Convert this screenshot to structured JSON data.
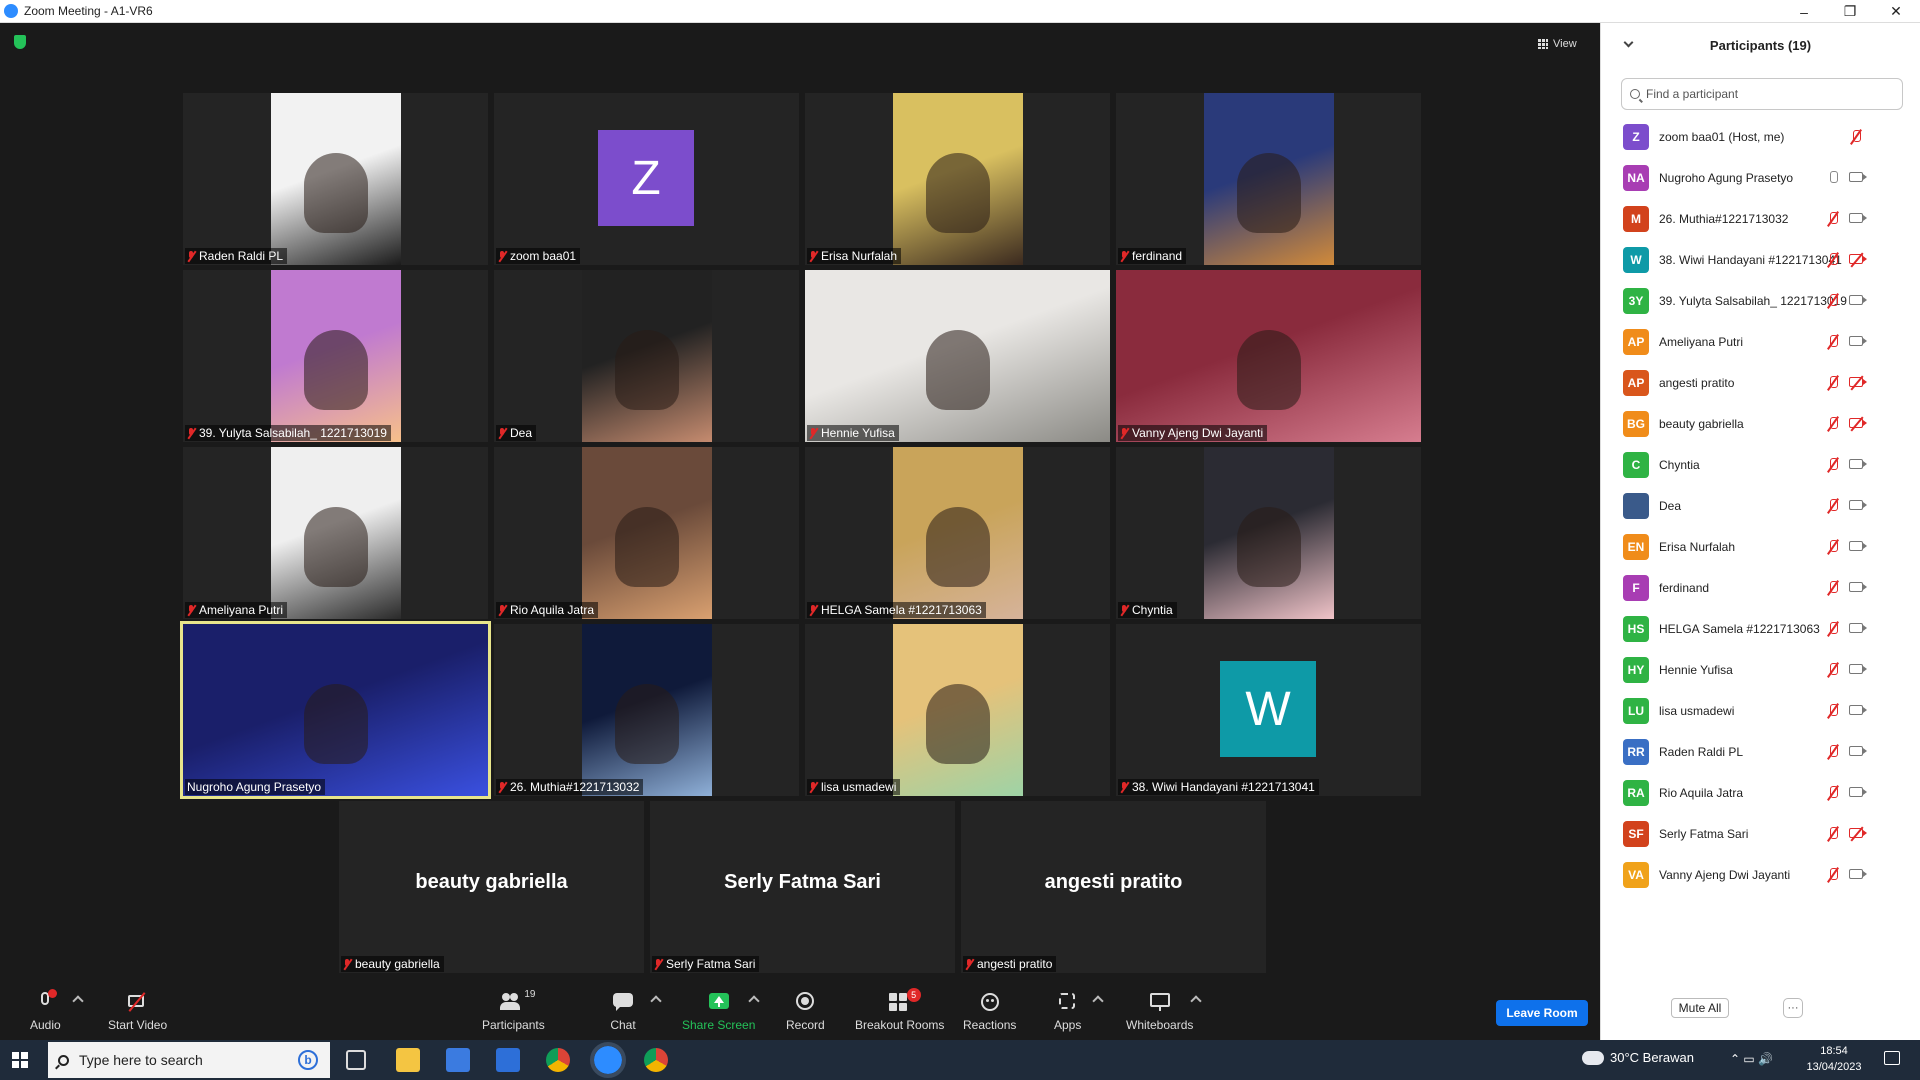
{
  "window": {
    "title": "Zoom Meeting - A1-VR6",
    "minimize": "–",
    "maximize": "❐",
    "close": "✕"
  },
  "meeting": {
    "view_label": "View"
  },
  "tiles": [
    {
      "name": "Raden Raldi PL",
      "muted": true,
      "kind": "video",
      "colors": [
        "#f2f2f2",
        "#1b1b1b"
      ]
    },
    {
      "name": "zoom baa01",
      "muted": true,
      "kind": "avatar",
      "initial": "Z",
      "avatar_color": "#7c4dcc"
    },
    {
      "name": "Erisa Nurfalah",
      "muted": true,
      "kind": "video",
      "colors": [
        "#d9c060",
        "#3b2a1f"
      ]
    },
    {
      "name": "ferdinand",
      "muted": true,
      "kind": "video",
      "colors": [
        "#2a3a7a",
        "#d18a3a"
      ]
    },
    {
      "name": "39. Yulyta Salsabilah_ 1221713019",
      "muted": true,
      "kind": "video",
      "colors": [
        "#c07ad0",
        "#f7c08a"
      ]
    },
    {
      "name": "Dea",
      "muted": true,
      "kind": "video",
      "colors": [
        "#222222",
        "#c58b6f"
      ]
    },
    {
      "name": "Hennie Yufisa",
      "muted": true,
      "kind": "video_full",
      "colors": [
        "#e9e7e4",
        "#8b8a85"
      ]
    },
    {
      "name": "Vanny Ajeng Dwi Jayanti",
      "muted": true,
      "kind": "video_full",
      "colors": [
        "#8a2b3d",
        "#d67d8f"
      ]
    },
    {
      "name": "Ameliyana Putri",
      "muted": true,
      "kind": "video",
      "colors": [
        "#efefef",
        "#2a2a2a"
      ]
    },
    {
      "name": "Rio Aquila Jatra",
      "muted": true,
      "kind": "video",
      "colors": [
        "#6a4a3a",
        "#d9a070"
      ]
    },
    {
      "name": "HELGA Samela #1221713063",
      "muted": true,
      "kind": "video",
      "colors": [
        "#c9a45a",
        "#d6b39a"
      ]
    },
    {
      "name": "Chyntia",
      "muted": true,
      "kind": "video",
      "colors": [
        "#2b2b33",
        "#f0c3c8"
      ]
    },
    {
      "name": "Nugroho Agung Prasetyo",
      "muted": false,
      "kind": "video_full",
      "active": true,
      "colors": [
        "#1a1f6a",
        "#3a50e0"
      ]
    },
    {
      "name": "26. Muthia#1221713032",
      "muted": true,
      "kind": "video",
      "colors": [
        "#0f1a3a",
        "#8fb0d8"
      ]
    },
    {
      "name": "lisa usmadewi",
      "muted": true,
      "kind": "video",
      "colors": [
        "#e5c27a",
        "#9ed3a6"
      ]
    },
    {
      "name": "38. Wiwi Handayani #1221713041",
      "muted": true,
      "kind": "avatar",
      "initial": "W",
      "avatar_color": "#0e9aa7"
    },
    {
      "name": "beauty gabriella",
      "muted": true,
      "kind": "name_only"
    },
    {
      "name": "Serly Fatma Sari",
      "muted": true,
      "kind": "name_only"
    },
    {
      "name": "angesti pratito",
      "muted": true,
      "kind": "name_only"
    }
  ],
  "toolbar": {
    "audio": "Audio",
    "start_video": "Start Video",
    "participants": "Participants",
    "participants_count": "19",
    "chat": "Chat",
    "share_screen": "Share Screen",
    "record": "Record",
    "breakout_rooms": "Breakout Rooms",
    "breakout_badge": "5",
    "reactions": "Reactions",
    "apps": "Apps",
    "whiteboards": "Whiteboards",
    "leave": "Leave Room",
    "accent": "#0e71eb",
    "share_color": "#24c259"
  },
  "panel": {
    "title": "Participants (19)",
    "search_placeholder": "Find a participant",
    "mute_all": "Mute All",
    "more": "···",
    "participants": [
      {
        "initials": "Z",
        "name": "zoom baa01 (Host, me)",
        "color": "#7c4dcc",
        "mic": "off",
        "cam": "none"
      },
      {
        "initials": "NA",
        "name": "Nugroho Agung Prasetyo",
        "color": "#a83db3",
        "mic": "on",
        "cam": "on"
      },
      {
        "initials": "M",
        "name": "26. Muthia#1221713032",
        "color": "#d2421c",
        "mic": "off",
        "cam": "on"
      },
      {
        "initials": "W",
        "name": "38. Wiwi Handayani #1221713041",
        "color": "#0e9aa7",
        "mic": "off",
        "cam": "off"
      },
      {
        "initials": "3Y",
        "name": "39. Yulyta Salsabilah_ 1221713019",
        "color": "#2fb344",
        "mic": "off",
        "cam": "on"
      },
      {
        "initials": "AP",
        "name": "Ameliyana Putri",
        "color": "#f08c1a",
        "mic": "off",
        "cam": "on"
      },
      {
        "initials": "AP",
        "name": "angesti pratito",
        "color": "#d9561c",
        "mic": "off",
        "cam": "off"
      },
      {
        "initials": "BG",
        "name": "beauty gabriella",
        "color": "#f08c1a",
        "mic": "off",
        "cam": "off"
      },
      {
        "initials": "C",
        "name": "Chyntia",
        "color": "#2fb344",
        "mic": "off",
        "cam": "on"
      },
      {
        "initials": "",
        "name": "Dea",
        "color": "#3a5a8a",
        "mic": "off",
        "cam": "on"
      },
      {
        "initials": "EN",
        "name": "Erisa Nurfalah",
        "color": "#f08c1a",
        "mic": "off",
        "cam": "on"
      },
      {
        "initials": "F",
        "name": "ferdinand",
        "color": "#a83db3",
        "mic": "off",
        "cam": "on"
      },
      {
        "initials": "HS",
        "name": "HELGA Samela #1221713063",
        "color": "#2fb344",
        "mic": "off",
        "cam": "on"
      },
      {
        "initials": "HY",
        "name": "Hennie Yufisa",
        "color": "#2fb344",
        "mic": "off",
        "cam": "on"
      },
      {
        "initials": "LU",
        "name": "lisa usmadewi",
        "color": "#2fb344",
        "mic": "off",
        "cam": "on"
      },
      {
        "initials": "RR",
        "name": "Raden Raldi PL",
        "color": "#3a6fc4",
        "mic": "off",
        "cam": "on"
      },
      {
        "initials": "RA",
        "name": "Rio Aquila Jatra",
        "color": "#2fb344",
        "mic": "off",
        "cam": "on"
      },
      {
        "initials": "SF",
        "name": "Serly Fatma Sari",
        "color": "#d2421c",
        "mic": "off",
        "cam": "off"
      },
      {
        "initials": "VA",
        "name": "Vanny Ajeng Dwi Jayanti",
        "color": "#f0a21a",
        "mic": "off",
        "cam": "on"
      }
    ]
  },
  "taskbar": {
    "search_placeholder": "Type here to search",
    "bing": "b",
    "weather": "30°C  Berawan",
    "time": "18:54",
    "date": "13/04/2023",
    "tray": "⌃  ▭  🔊"
  }
}
